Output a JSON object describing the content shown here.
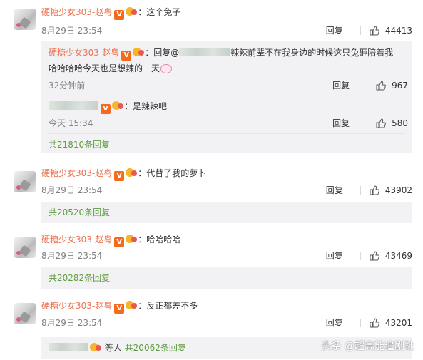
{
  "comments": [
    {
      "username": "硬糖少女303-赵粤",
      "text": "：这个兔子",
      "date": "8月29日 23:54",
      "reply_label": "回复",
      "likes": "44413",
      "replies": [
        {
          "username": "硬糖少女303-赵粤",
          "text_prefix": "：回复@",
          "text_line1": "辣辣前辈不在我身边的时候这只兔砸陪着我",
          "text_line2": "哈哈哈哈今天也是想辣的一天",
          "time": "32分钟前",
          "reply_label": "回复",
          "likes": "967"
        },
        {
          "text": "：是辣辣吧",
          "time": "今天 15:34",
          "reply_label": "回复",
          "likes": "580"
        }
      ],
      "reply_count_label": "共21810条回复"
    },
    {
      "username": "硬糖少女303-赵粤",
      "text": "：代替了我的萝卜",
      "date": "8月29日 23:54",
      "reply_label": "回复",
      "likes": "43902",
      "reply_count_label": "共20520条回复"
    },
    {
      "username": "硬糖少女303-赵粤",
      "text": "：哈哈哈哈",
      "date": "8月29日 23:54",
      "reply_label": "回复",
      "likes": "43469",
      "reply_count_label": "共20282条回复"
    },
    {
      "username": "硬糖少女303-赵粤",
      "text": "：反正都差不多",
      "date": "8月29日 23:54",
      "reply_label": "回复",
      "likes": "43201",
      "others_label": "等人",
      "reply_count_label": "共20062条回复"
    }
  ],
  "badges": {
    "verified": "V"
  },
  "watermark": "头条 @超高能追剧社",
  "colors": {
    "username": "#eb7350",
    "reply_link": "#5f9c3f",
    "subbox_bg": "#f2f2f5",
    "verified": "#f56b1d"
  },
  "icons": {
    "like": "thumbs-up-icon",
    "verified": "verified-v-icon",
    "fan": "fan-badge-icon"
  }
}
